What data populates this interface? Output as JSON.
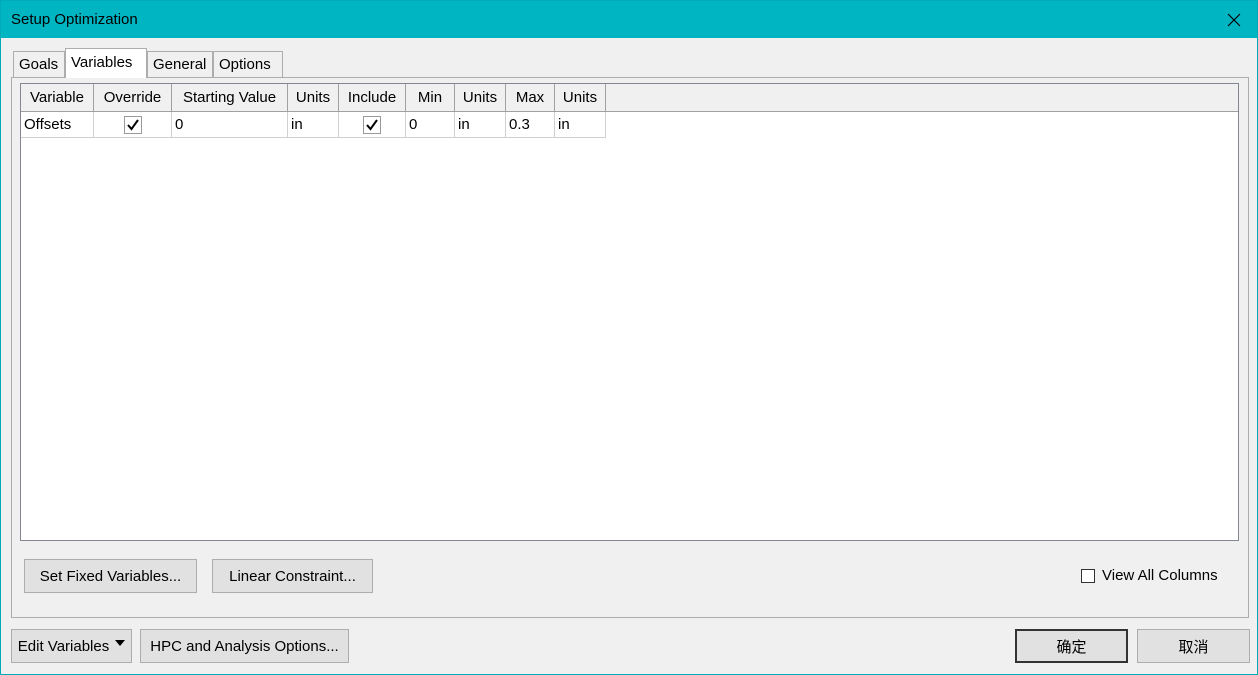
{
  "window": {
    "title": "Setup Optimization"
  },
  "tabs": [
    {
      "label": "Goals"
    },
    {
      "label": "Variables"
    },
    {
      "label": "General"
    },
    {
      "label": "Options"
    }
  ],
  "table": {
    "headers": [
      "Variable",
      "Override",
      "Starting Value",
      "Units",
      "Include",
      "Min",
      "Units",
      "Max",
      "Units"
    ],
    "rows": [
      {
        "variable": "Offsets",
        "override": true,
        "starting_value": "0",
        "units1": "in",
        "include": true,
        "min": "0",
        "units2": "in",
        "max": "0.3",
        "units3": "in"
      }
    ]
  },
  "buttons": {
    "set_fixed": "Set Fixed Variables...",
    "linear_constraint": "Linear Constraint...",
    "edit_variables": "Edit Variables",
    "hpc_options": "HPC and Analysis Options...",
    "ok": "确定",
    "cancel": "取消"
  },
  "view_all_columns": {
    "label": "View All Columns",
    "checked": false
  },
  "colors": {
    "titlebar": "#00b5c2",
    "background": "#f0f0f0"
  }
}
